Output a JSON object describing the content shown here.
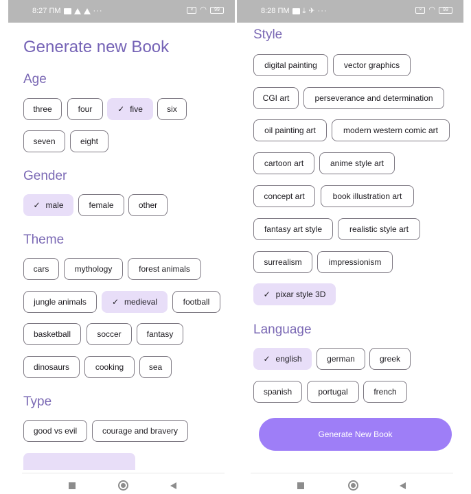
{
  "left": {
    "status_bar": {
      "time": "8:27 ПМ",
      "battery": "99"
    },
    "title": "Generate new Book",
    "age": {
      "title": "Age",
      "chips": [
        {
          "label": "three",
          "selected": false
        },
        {
          "label": "four",
          "selected": false
        },
        {
          "label": "five",
          "selected": true
        },
        {
          "label": "six",
          "selected": false
        },
        {
          "label": "seven",
          "selected": false
        },
        {
          "label": "eight",
          "selected": false
        }
      ]
    },
    "gender": {
      "title": "Gender",
      "chips": [
        {
          "label": "male",
          "selected": true
        },
        {
          "label": "female",
          "selected": false
        },
        {
          "label": "other",
          "selected": false
        }
      ]
    },
    "theme": {
      "title": "Theme",
      "chips": [
        {
          "label": "cars",
          "selected": false
        },
        {
          "label": "mythology",
          "selected": false
        },
        {
          "label": "forest animals",
          "selected": false
        },
        {
          "label": "jungle animals",
          "selected": false
        },
        {
          "label": "medieval",
          "selected": true
        },
        {
          "label": "football",
          "selected": false
        },
        {
          "label": "basketball",
          "selected": false
        },
        {
          "label": "soccer",
          "selected": false
        },
        {
          "label": "fantasy",
          "selected": false
        },
        {
          "label": "dinosaurs",
          "selected": false
        },
        {
          "label": "cooking",
          "selected": false
        },
        {
          "label": "sea",
          "selected": false
        }
      ]
    },
    "type": {
      "title": "Type",
      "chips": [
        {
          "label": "good vs evil",
          "selected": false
        },
        {
          "label": "courage and bravery",
          "selected": false
        }
      ]
    }
  },
  "right": {
    "status_bar": {
      "time": "8:28 ПМ",
      "battery": "99"
    },
    "style": {
      "title": "Style",
      "chips": [
        {
          "label": "digital painting",
          "selected": false
        },
        {
          "label": "vector graphics",
          "selected": false
        },
        {
          "label": "CGI art",
          "selected": false
        },
        {
          "label": "perseverance and determination",
          "selected": false
        },
        {
          "label": "oil painting art",
          "selected": false
        },
        {
          "label": "modern western comic art",
          "selected": false
        },
        {
          "label": "cartoon art",
          "selected": false
        },
        {
          "label": "anime style art",
          "selected": false
        },
        {
          "label": "concept art",
          "selected": false
        },
        {
          "label": "book illustration art",
          "selected": false
        },
        {
          "label": "fantasy art style",
          "selected": false
        },
        {
          "label": "realistic style art",
          "selected": false
        },
        {
          "label": "surrealism",
          "selected": false
        },
        {
          "label": "impressionism",
          "selected": false
        },
        {
          "label": "pixar style 3D",
          "selected": true
        }
      ]
    },
    "language": {
      "title": "Language",
      "chips": [
        {
          "label": "english",
          "selected": true
        },
        {
          "label": "german",
          "selected": false
        },
        {
          "label": "greek",
          "selected": false
        },
        {
          "label": "spanish",
          "selected": false
        },
        {
          "label": "portugal",
          "selected": false
        },
        {
          "label": "french",
          "selected": false
        }
      ]
    },
    "generate_button": "Generate New Book"
  },
  "colors": {
    "accent": "#7563b6",
    "chip_selected": "#e8def8",
    "chip_border": "#7d7882",
    "button": "#9e7ef7",
    "status_bar": "#b7b7b7"
  },
  "icons": {
    "check": "check-icon",
    "nav_recents": "square-icon",
    "nav_home": "circle-icon",
    "nav_back": "triangle-back-icon"
  }
}
